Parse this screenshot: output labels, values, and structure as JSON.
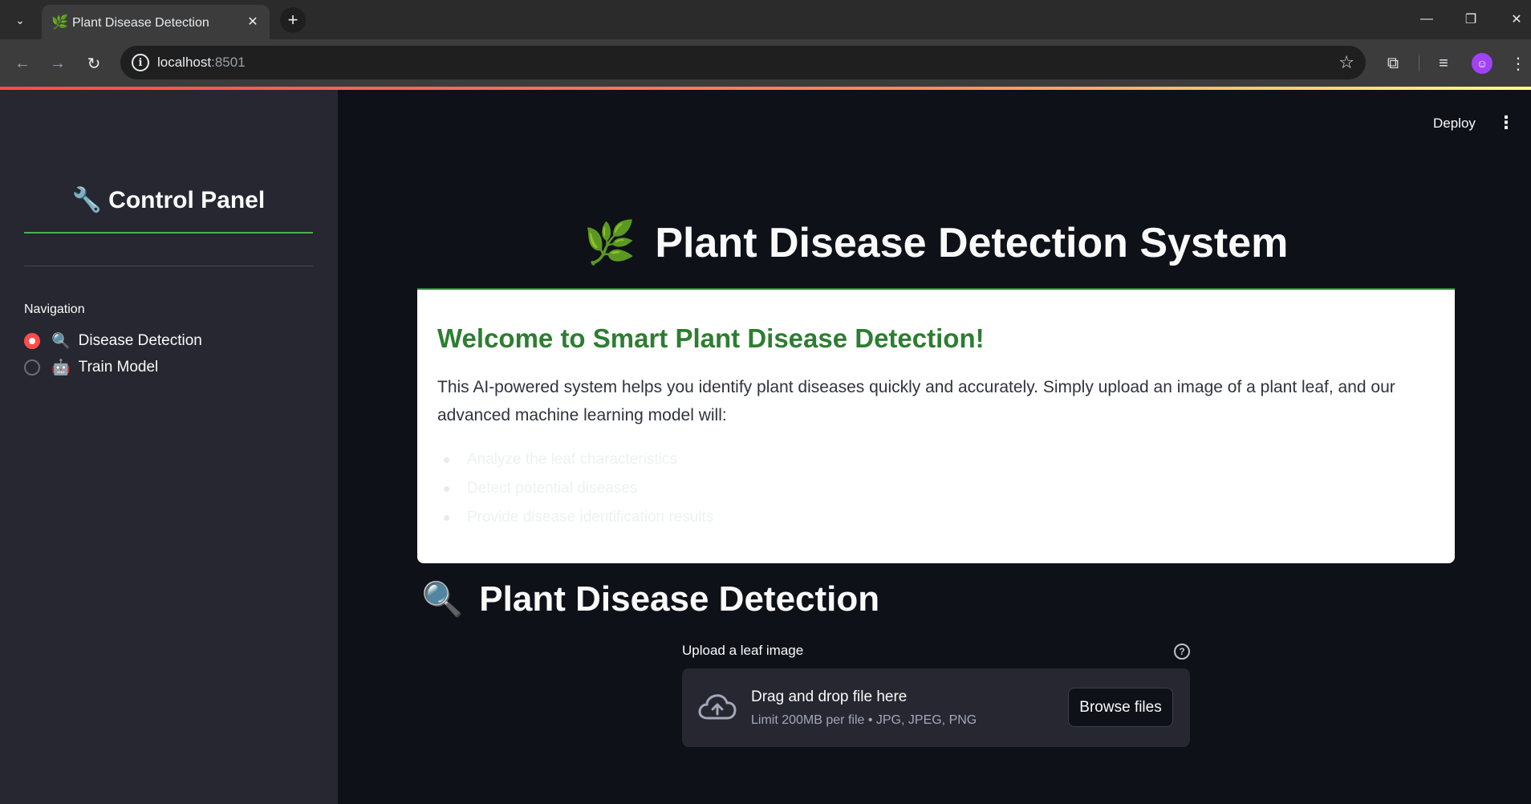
{
  "browser": {
    "tab_title": "Plant Disease Detection",
    "tab_favicon": "🌿",
    "url_host": "localhost",
    "url_port": ":8501"
  },
  "sidebar": {
    "title_icon": "🔧",
    "title": "Control Panel",
    "nav_label": "Navigation",
    "nav_items": [
      {
        "emoji": "🔍",
        "label": "Disease Detection",
        "selected": true
      },
      {
        "emoji": "🤖",
        "label": "Train Model",
        "selected": false
      }
    ]
  },
  "header": {
    "deploy_label": "Deploy"
  },
  "hero": {
    "icon": "🌿",
    "title": "Plant Disease Detection System"
  },
  "welcome": {
    "title": "Welcome to Smart Plant Disease Detection!",
    "body": "This AI-powered system helps you identify plant diseases quickly and accurately. Simply upload an image of a plant leaf, and our advanced machine learning model will:",
    "bullets": [
      "Analyze the leaf characteristics",
      "Detect potential diseases",
      "Provide disease identification results"
    ]
  },
  "detection": {
    "icon": "🔍",
    "title": "Plant Disease Detection",
    "upload_label": "Upload a leaf image",
    "drop_text": "Drag and drop file here",
    "limit_text": "Limit 200MB per file • JPG, JPEG, PNG",
    "browse_label": "Browse files"
  }
}
